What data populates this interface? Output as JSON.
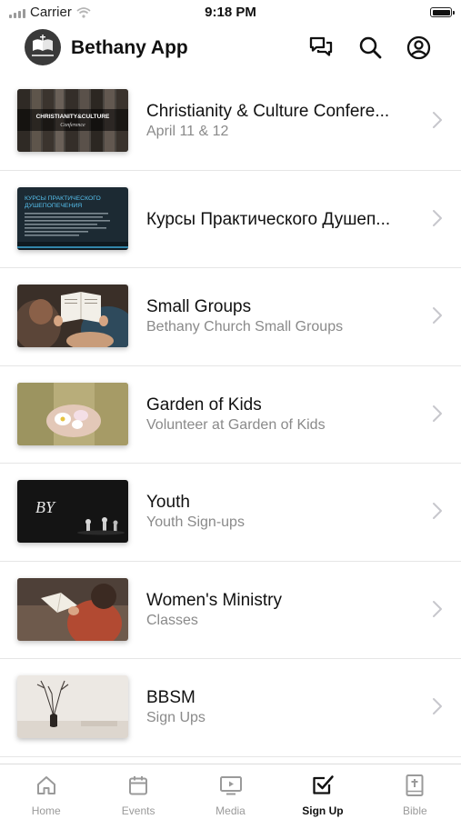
{
  "status_bar": {
    "carrier": "Carrier",
    "time": "9:18 PM"
  },
  "header": {
    "title": "Bethany App",
    "icons": [
      "chat-icon",
      "search-icon",
      "account-icon"
    ]
  },
  "list": [
    {
      "title": "Christianity & Culture Confere...",
      "subtitle": "April 11 & 12",
      "thumb_text_1": "CHRISTIANITY&CULTURE",
      "thumb_text_2": "Conference"
    },
    {
      "title": "Курсы Практического Душеп...",
      "subtitle": "",
      "thumb_text_1": "КУРСЫ ПРАКТИЧЕСКОГО",
      "thumb_text_2": "ДУШЕПОПЕЧЕНИЯ"
    },
    {
      "title": "Small Groups",
      "subtitle": "Bethany Church Small Groups"
    },
    {
      "title": "Garden of Kids",
      "subtitle": "Volunteer at Garden of Kids"
    },
    {
      "title": "Youth",
      "subtitle": "Youth Sign-ups",
      "thumb_text_1": "BY"
    },
    {
      "title": "Women's Ministry",
      "subtitle": "Classes"
    },
    {
      "title": "BBSM",
      "subtitle": "Sign Ups"
    }
  ],
  "tabs": [
    {
      "label": "Home",
      "icon": "home-icon"
    },
    {
      "label": "Events",
      "icon": "calendar-icon"
    },
    {
      "label": "Media",
      "icon": "media-icon"
    },
    {
      "label": "Sign Up",
      "icon": "checkbox-icon",
      "active": true
    },
    {
      "label": "Bible",
      "icon": "bible-icon"
    }
  ],
  "colors": {
    "active_tab": "#111111",
    "inactive_tab": "#9a9a9a",
    "subtitle": "#8a8a8a",
    "divider": "#e6e6e6"
  }
}
